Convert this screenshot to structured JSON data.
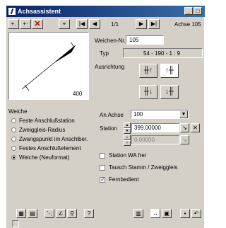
{
  "window": {
    "title": "Achsassistent"
  },
  "toolbar": {
    "page": "1/1",
    "achse_label": "Achse 105",
    "icons": [
      "add-point-icon",
      "add-segment-icon",
      "delete-icon",
      "pick-icon",
      "first-icon",
      "prev-icon",
      "next-icon",
      "last-icon"
    ]
  },
  "preview": {
    "value": "400"
  },
  "weichen_nr": {
    "label": "Weichen-Nr.",
    "value": "105"
  },
  "typ": {
    "label": "Typ",
    "value": "54 - 190 - 1 : 9"
  },
  "ausrichtung": {
    "label": "Ausrichtung"
  },
  "weiche": {
    "label": "Weiche",
    "options": [
      "Feste Anschlußstation",
      "Zweiggleis-Radius",
      "Zwangspunkt im Anschlber.",
      "Festes Anschlußelement",
      "Weiche (Neuformat)"
    ],
    "selected_index": 4
  },
  "an_achse": {
    "label": "An Achse",
    "value": "100"
  },
  "station": {
    "label": "Station",
    "value": "399.00000",
    "offset": "0.00000"
  },
  "checkboxes": {
    "station_wa": {
      "label": "Station WA frei",
      "checked": false
    },
    "tausch": {
      "label": "Tausch Stamm / Zweiggleis",
      "checked": false
    },
    "fernbedient": {
      "label": "Fernbedient",
      "checked": true
    }
  },
  "bottom_icons": [
    "grid-icon",
    "table-icon",
    "measure-icon",
    "angle-icon",
    "zoom-icon",
    "help-icon",
    "layout-icon",
    "arrows-icon",
    "image-icon",
    "save-icon",
    "undo-icon"
  ]
}
